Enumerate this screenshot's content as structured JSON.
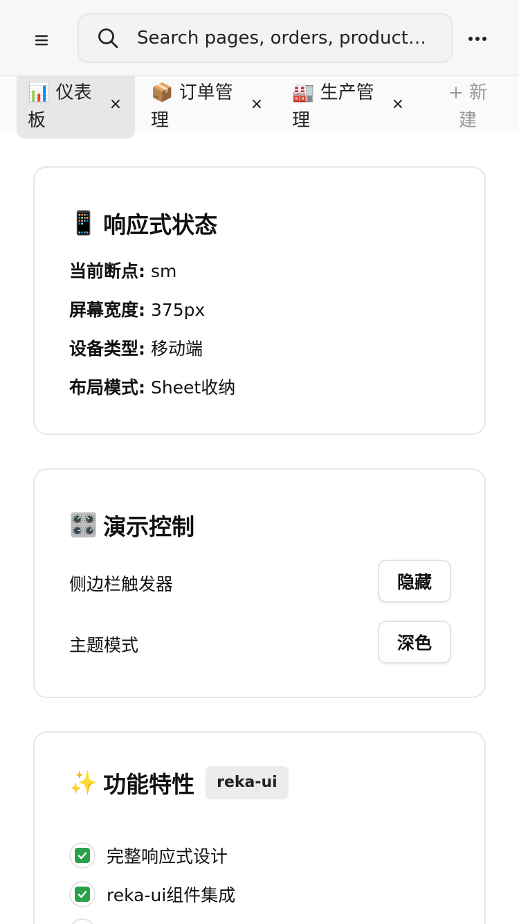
{
  "header": {
    "menu_icon": "hamburger-icon",
    "search_icon": "search-icon",
    "search_placeholder": "Search pages, orders, product…",
    "more_icon": "more-horizontal-icon"
  },
  "tabs": [
    {
      "label": "📊 仪表板",
      "close": "×",
      "active": true
    },
    {
      "label": "📦 订单管理",
      "close": "×",
      "active": false
    },
    {
      "label": "🏭 生产管理",
      "close": "×",
      "active": false
    }
  ],
  "new_tab_label": "+ 新建",
  "responsive_card": {
    "title_emoji": "📱",
    "title": "响应式状态",
    "rows": [
      {
        "key": "当前断点:",
        "value": "sm"
      },
      {
        "key": "屏幕宽度:",
        "value": "375px"
      },
      {
        "key": "设备类型:",
        "value": "移动端"
      },
      {
        "key": "布局模式:",
        "value": "Sheet收纳"
      }
    ]
  },
  "demo_card": {
    "title_emoji": "🎛️",
    "title": "演示控制",
    "controls": [
      {
        "label": "侧边栏触发器",
        "button": "隐藏"
      },
      {
        "label": "主题模式",
        "button": "深色"
      }
    ]
  },
  "features_card": {
    "title_emoji": "✨",
    "title": "功能特性",
    "badge": "reka-ui",
    "items": [
      {
        "label": "完整响应式设计"
      },
      {
        "label": "reka-ui组件集成"
      }
    ]
  },
  "colors": {
    "check_green": "#2aa148",
    "tab_active_bg": "#e7e7e7",
    "card_border": "#e6e6e6"
  }
}
